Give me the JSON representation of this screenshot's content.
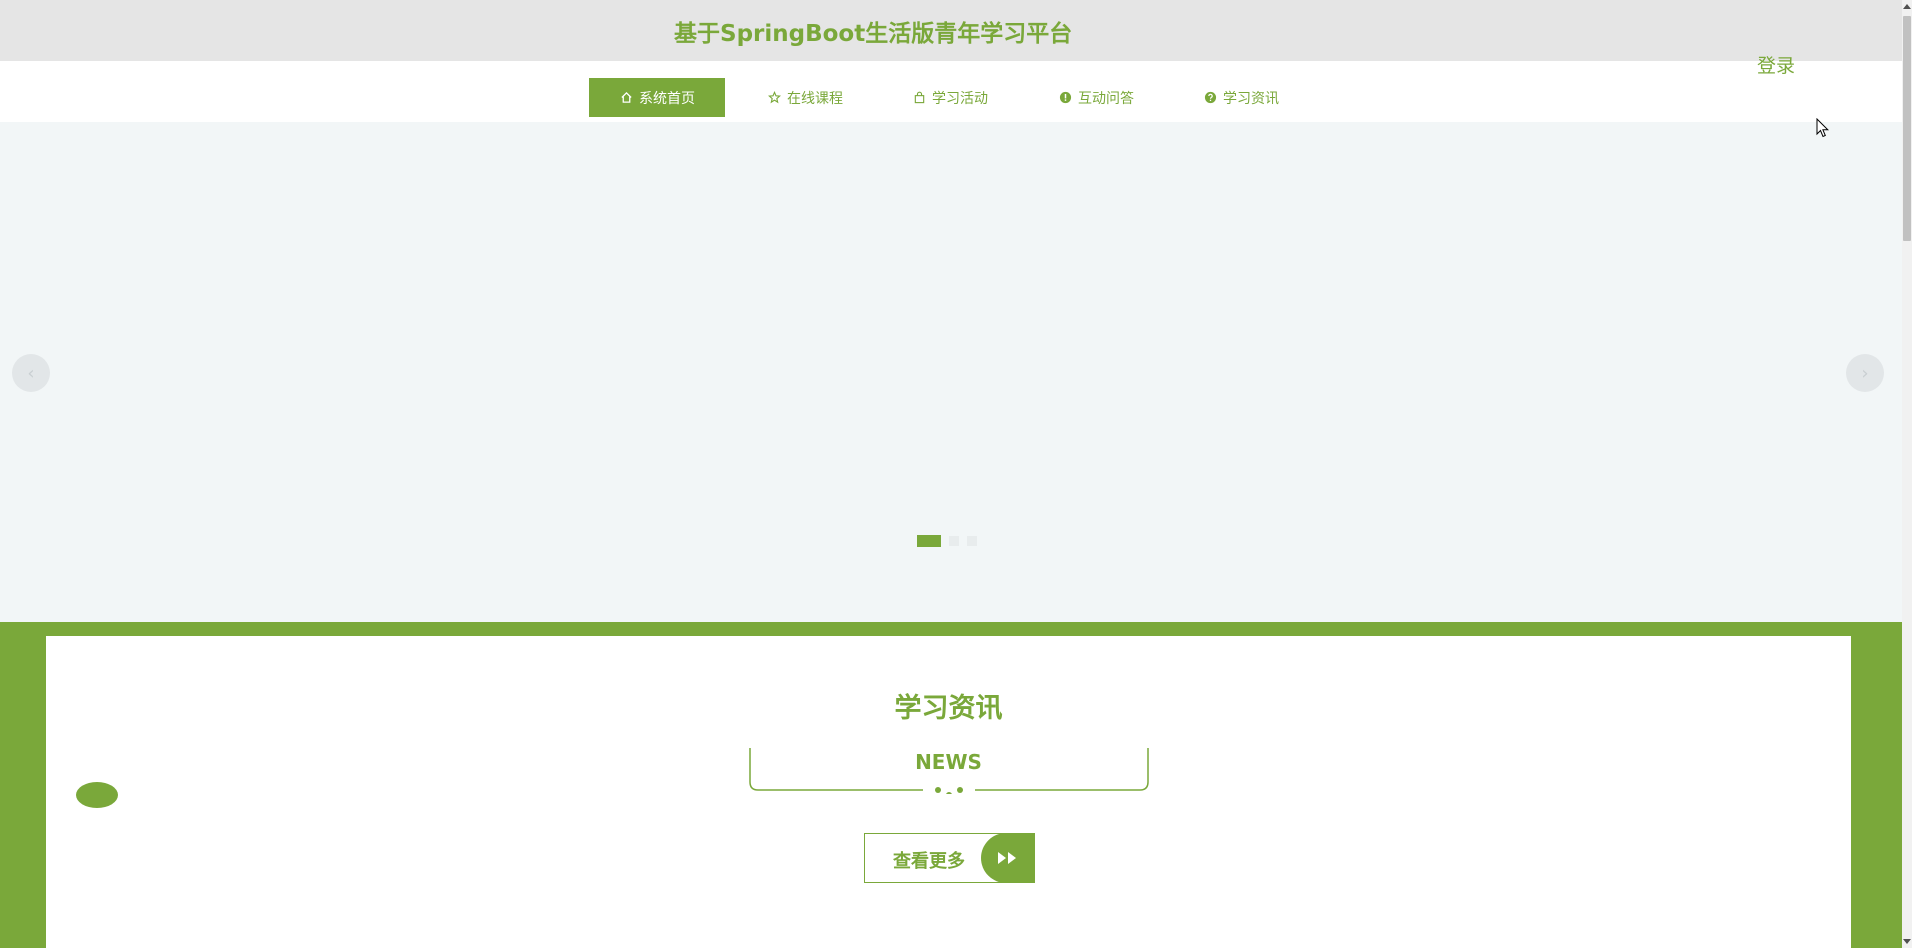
{
  "header": {
    "title": "基于SpringBoot生活版青年学习平台"
  },
  "nav": {
    "items": [
      {
        "label": "系统首页",
        "icon": "home-icon",
        "active": true
      },
      {
        "label": "在线课程",
        "icon": "star-icon",
        "active": false
      },
      {
        "label": "学习活动",
        "icon": "bag-icon",
        "active": false
      },
      {
        "label": "互动问答",
        "icon": "info-circle-icon",
        "active": false
      },
      {
        "label": "学习资讯",
        "icon": "question-circle-icon",
        "active": false
      }
    ],
    "login_label": "登录"
  },
  "carousel": {
    "prev_label": "‹",
    "next_label": "›",
    "slide_count": 3,
    "active_index": 0
  },
  "news": {
    "title": "学习资讯",
    "subtitle": "NEWS",
    "more_label": "查看更多"
  },
  "colors": {
    "accent": "#7aa83a",
    "topbar_bg": "#e5e5e5",
    "carousel_bg": "#f2f6f7"
  }
}
